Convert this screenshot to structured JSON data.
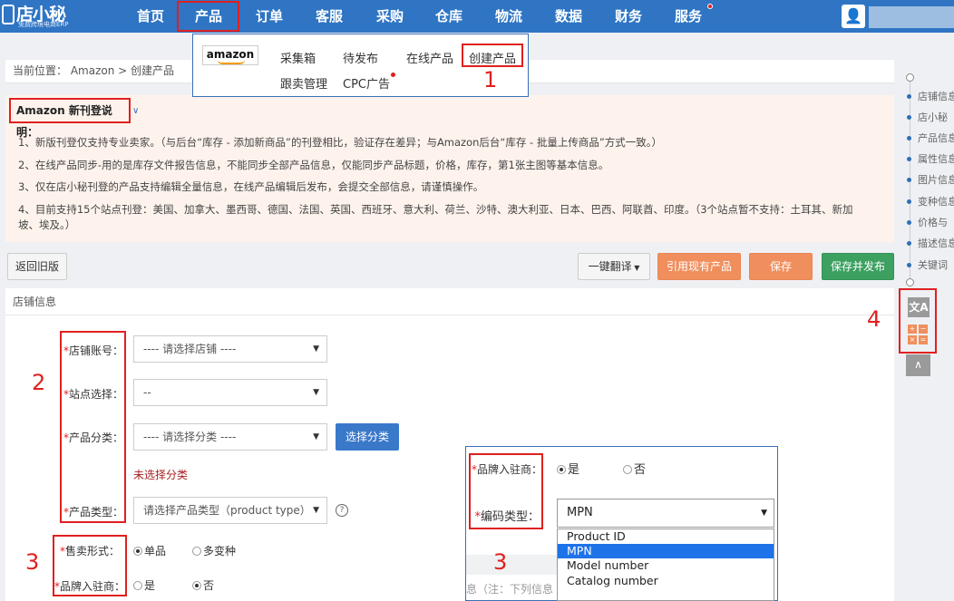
{
  "nav": {
    "logo_text": "店小秘",
    "logo_sub": "免费跨境电商ERP",
    "items": [
      {
        "label": "首页"
      },
      {
        "label": "产品"
      },
      {
        "label": "订单"
      },
      {
        "label": "客服"
      },
      {
        "label": "采购"
      },
      {
        "label": "仓库"
      },
      {
        "label": "物流"
      },
      {
        "label": "数据"
      },
      {
        "label": "财务"
      },
      {
        "label": "服务"
      }
    ],
    "avatar_icon": "user-icon"
  },
  "breadcrumb": "当前位置： Amazon > 创建产品",
  "product_menu": {
    "platform_logo": "amazon",
    "row1": [
      "采集箱",
      "待发布",
      "在线产品",
      "创建产品"
    ],
    "row2": [
      "跟卖管理",
      "CPC广告"
    ]
  },
  "annotations": [
    "1",
    "2",
    "3",
    "3",
    "4"
  ],
  "notice": {
    "title": "Amazon 新刊登说明：",
    "lines": [
      "1、新版刊登仅支持专业卖家。（与后台“库存 - 添加新商品”的刊登相比，验证存在差异；与Amazon后台“库存 - 批量上传商品”方式一致。）",
      "2、在线产品同步-用的是库存文件报告信息，不能同步全部产品信息，仅能同步产品标题，价格，库存，第1张主图等基本信息。",
      "3、仅在店小秘刊登的产品支持编辑全量信息，在线产品编辑后发布，会提交全部信息，请谨慎操作。",
      "4、目前支持15个站点刊登：美国、加拿大、墨西哥、德国、法国、英国、西班牙、意大利、荷兰、沙特、澳大利亚、日本、巴西、阿联酋、印度。（3个站点暂不支持：土耳其、新加",
      "坡、埃及。）"
    ]
  },
  "toolbar": {
    "back_label": "返回旧版",
    "translate_label": "一键翻译",
    "cite_label": "引用现有产品",
    "save_label": "保存",
    "save_publish_label": "保存并发布"
  },
  "form": {
    "section_title": "店铺信息",
    "store_label": "店铺账号：",
    "store_value": "---- 请选择店铺 ----",
    "site_label": "站点选择：",
    "site_value": "--",
    "category_label": "产品分类：",
    "category_value": "---- 请选择分类 ----",
    "choose_category_label": "选择分类",
    "no_category_text": "未选择分类",
    "type_label": "产品类型：",
    "type_value": "请选择产品类型（product type）",
    "sale_label": "售卖形式：",
    "sale_options": [
      "单品",
      "多变种"
    ],
    "brand_label": "品牌入驻商：",
    "brand_options": [
      "是",
      "否"
    ]
  },
  "inset": {
    "brand_label": "品牌入驻商：",
    "brand_options": [
      "是",
      "否"
    ],
    "encode_label": "编码类型：",
    "encode_value": "MPN",
    "encode_options": [
      "Product ID",
      "MPN",
      "Model number",
      "Catalog number"
    ],
    "faint_text": "息（注：下列信息"
  },
  "rail": {
    "items": [
      "店铺信息",
      "店小秘",
      "产品信息",
      "属性信息",
      "图片信息",
      "变种信息",
      "价格与",
      "描述信息",
      "关键词"
    ],
    "translate_icon": "translate-icon",
    "calc_icon": "calculator-icon",
    "calc_symbols": [
      "+",
      "−",
      "×",
      "="
    ],
    "top_icon": "chevron-up-icon"
  }
}
